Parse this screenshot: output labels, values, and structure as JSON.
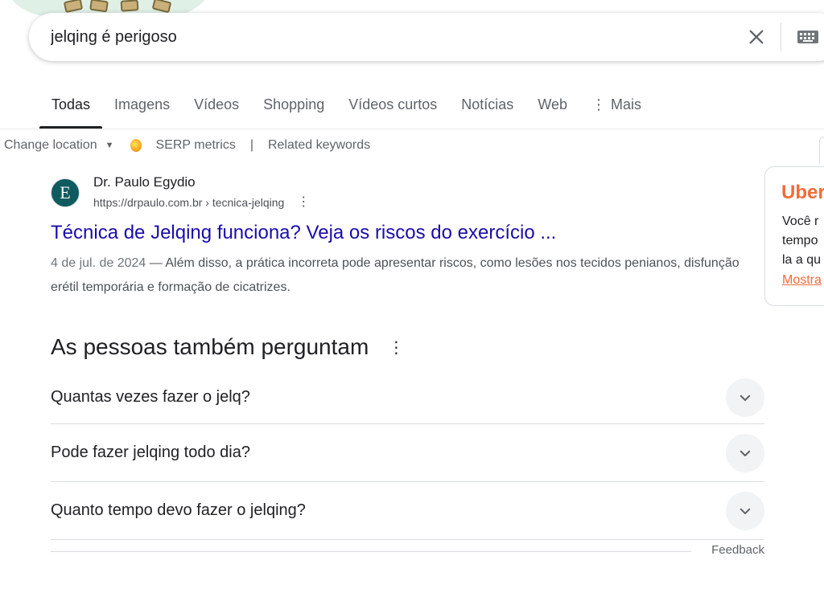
{
  "search": {
    "query": "jelqing é perigoso"
  },
  "tabs": [
    {
      "label": "Todas"
    },
    {
      "label": "Imagens"
    },
    {
      "label": "Vídeos"
    },
    {
      "label": "Shopping"
    },
    {
      "label": "Vídeos curtos"
    },
    {
      "label": "Notícias"
    },
    {
      "label": "Web"
    },
    {
      "label": "Mais"
    }
  ],
  "extension_bar": {
    "change_location": "Change location",
    "serp_metrics": "SERP metrics",
    "separator": "|",
    "related_keywords": "Related keywords"
  },
  "result": {
    "favicon_letter": "E",
    "site_name": "Dr. Paulo Egydio",
    "url": "https://drpaulo.com.br › tecnica-jelqing",
    "title": "Técnica de Jelqing funciona? Veja os riscos do exercício ...",
    "date": "4 de jul. de 2024",
    "snippet": " — Além disso, a prática incorreta pode apresentar riscos, como lesões nos tecidos penianos, disfunção erétil temporária e formação de cicatrizes."
  },
  "people_also_ask": {
    "title": "As pessoas também perguntam",
    "questions": [
      "Quantas vezes fazer o jelq?",
      "Pode fazer jelqing todo dia?",
      "Quanto tempo devo fazer o jelqing?"
    ],
    "feedback": "Feedback"
  },
  "side_card": {
    "title": "Uber",
    "lines": [
      "Você r",
      "tempo",
      "la a qu"
    ],
    "link": "Mostra"
  },
  "colors": {
    "link_blue": "#1a0dab",
    "accent_orange": "#f26b3a"
  }
}
